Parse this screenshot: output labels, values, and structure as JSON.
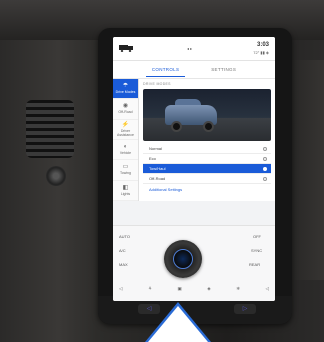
{
  "status_bar": {
    "signal_text": "◂ ▸",
    "time": "3:03",
    "temp": "72° ▮▮ ◈"
  },
  "tabs": [
    {
      "label": "CONTROLS",
      "active": true
    },
    {
      "label": "SETTINGS",
      "active": false
    }
  ],
  "sidebar": {
    "items": [
      {
        "icon": "☂",
        "label": "Drive Modes",
        "active": true
      },
      {
        "icon": "◉",
        "label": "Off-Road",
        "active": false
      },
      {
        "icon": "⚡",
        "label": "Driver Assistance",
        "active": false
      },
      {
        "icon": "◐",
        "label": "Vehicle",
        "active": false
      },
      {
        "icon": "▭",
        "label": "Towing",
        "active": false
      },
      {
        "icon": "◧",
        "label": "Lights",
        "active": false
      }
    ]
  },
  "main": {
    "section_label": "DRIVE MODES",
    "modes": [
      {
        "label": "Normal",
        "selected": false
      },
      {
        "label": "Eco",
        "selected": false
      },
      {
        "label": "Tow/Haul",
        "selected": true
      },
      {
        "label": "Off-Road",
        "selected": false
      }
    ],
    "link_label": "Additional Settings"
  },
  "climate": {
    "left_items": [
      "AUTO",
      "A/C",
      "MAX"
    ],
    "right_items": [
      "OFF",
      "SYNC",
      "REAR"
    ],
    "bottom_items": [
      "◁",
      "⚘",
      "▣",
      "◈",
      "❄",
      "◁"
    ]
  },
  "hardware_buttons": [
    "◁",
    "◉",
    "▷"
  ],
  "colors": {
    "accent": "#1a5bd8",
    "arrow_outline": "#2b6cd6"
  }
}
